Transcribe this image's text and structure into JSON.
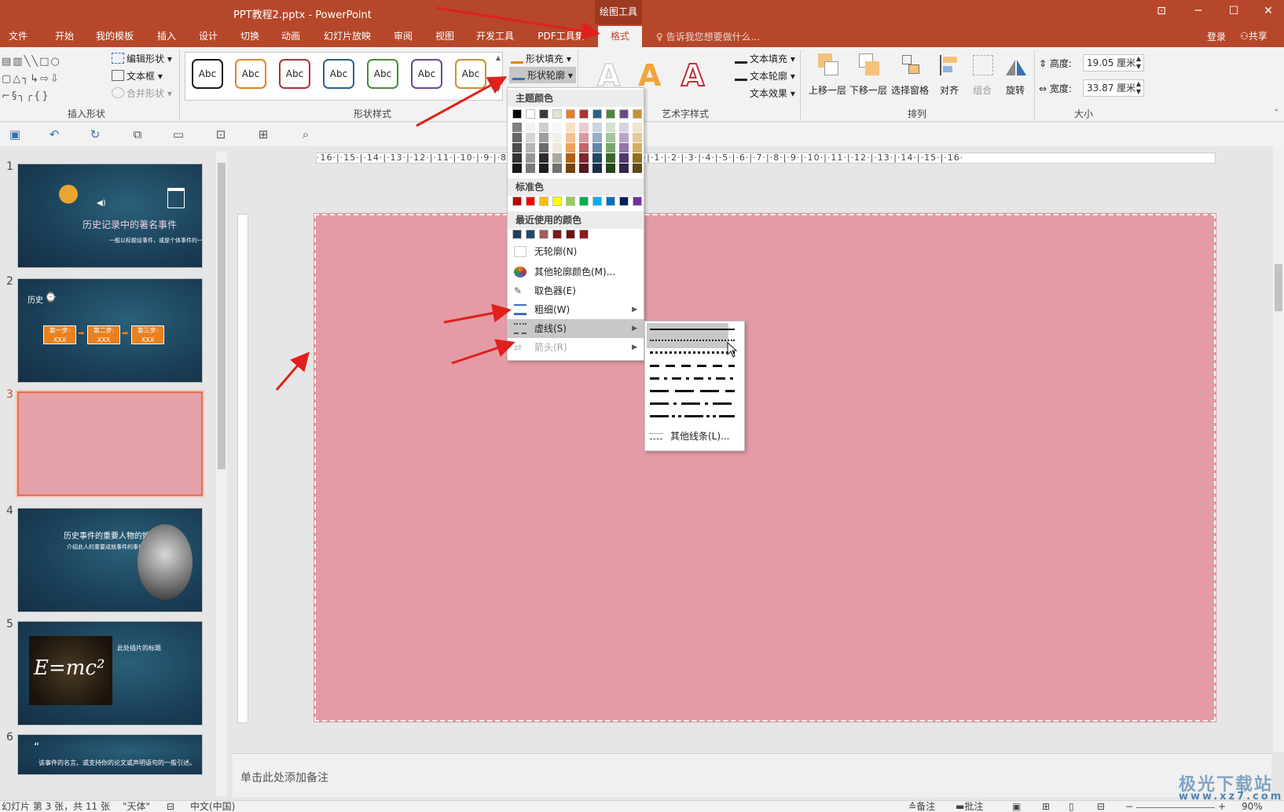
{
  "window": {
    "title": "PPT教程2.pptx - PowerPoint",
    "context_group": "绘图工具",
    "buttons": [
      "⊡",
      "─",
      "☐",
      "✕"
    ]
  },
  "tabs": [
    "文件",
    "开始",
    "我的模板",
    "插入",
    "设计",
    "切换",
    "动画",
    "幻灯片放映",
    "审阅",
    "视图",
    "开发工具",
    "PDF工具集",
    "格式"
  ],
  "active_tab": "格式",
  "tell_me": "告诉我您想要做什么...",
  "account": {
    "login": "登录",
    "share": "共享"
  },
  "ribbon": {
    "insert_shapes": {
      "label": "插入形状",
      "edit_shape": "编辑形状",
      "text_box": "文本框",
      "merge_shapes": "合并形状"
    },
    "shape_styles": {
      "label": "形状样式",
      "sample_text": "Abc",
      "sample_colors": [
        "#1a1a1a",
        "#e8811e",
        "#a9343a",
        "#2e5f8a",
        "#4a8a3c",
        "#6b4a8a",
        "#c4942c"
      ],
      "fill": "形状填充",
      "outline": "形状轮廓"
    },
    "wordart": {
      "label": "艺术字样式",
      "text_fill": "文本填充",
      "text_outline": "文本轮廓",
      "text_effect": "文本效果",
      "glyph": "A"
    },
    "arrange": {
      "label": "排列",
      "bring_forward": "上移一层",
      "send_backward": "下移一层",
      "selection_pane": "选择窗格",
      "align": "对齐",
      "group": "组合",
      "rotate": "旋转"
    },
    "size": {
      "label": "大小",
      "height_label": "高度:",
      "height_value": "19.05 厘米",
      "width_label": "宽度:",
      "width_value": "33.87 厘米"
    }
  },
  "outline_menu": {
    "theme_colors_header": "主题颜色",
    "theme_colors": [
      "#000000",
      "#ffffff",
      "#3a3a3a",
      "#e7e0d6",
      "#e8811e",
      "#a9343a",
      "#2e5f8a",
      "#4a8a3c",
      "#6b4a8a",
      "#c4942c"
    ],
    "standard_header": "标准色",
    "standard_colors": [
      "#c00000",
      "#ff0000",
      "#ffc000",
      "#ffff00",
      "#92d050",
      "#00b050",
      "#00b0f0",
      "#0070c0",
      "#002060",
      "#7030a0"
    ],
    "recent_header": "最近使用的颜色",
    "recent_colors": [
      "#1f3f5a",
      "#1f4a6e",
      "#a45a5a",
      "#7a1a14",
      "#6a1610",
      "#8a1a1a"
    ],
    "no_outline": "无轮廓(N)",
    "more_colors": "其他轮廓颜色(M)...",
    "eyedropper": "取色器(E)",
    "weight": "粗细(W)",
    "dashes": "虚线(S)",
    "arrows": "箭头(R)"
  },
  "dash_menu": {
    "more_lines": "其他线条(L)..."
  },
  "slides": [
    {
      "num": "1",
      "title": "历史记录中的著名事件",
      "subtitle": "一般以标题设事件，或是个体事件的一般记录。"
    },
    {
      "num": "2",
      "title": "历史",
      "steps": [
        "第一步:",
        "第二步:",
        "第三步:"
      ],
      "step_sub": "XXX"
    },
    {
      "num": "3"
    },
    {
      "num": "4",
      "title": "历史事件的重要人物的姓名",
      "subtitle": "介绍此人的重要成就事件的事件。"
    },
    {
      "num": "5",
      "title": "此处插片的标题",
      "formula": "E=mc²"
    },
    {
      "num": "6",
      "quote": "该事件的名言、或支持你的论文或声明语句的一般引述。"
    }
  ],
  "ruler_h": "·16·|·15·|·14·|·13·|·12·|·11·|·10·|·9·|·8·|·7·|·6·|·5·|·4·|·3·|·2·|·1·|·0·|·1·|·2·|·3·|·4·|·5·|·6·|·7·|·8·|·9·|·10·|·11·|·12·|·13·|·14·|·15·|·16·",
  "notes_placeholder": "单击此处添加备注",
  "status": {
    "slide_info": "幻灯片 第 3 张，共 11 张",
    "font": "\"天体\"",
    "language": "中文(中国)",
    "notes": "备注",
    "comments": "批注",
    "zoom": "90%"
  },
  "watermark": {
    "title": "极光下载站",
    "url": "www.xz7.com"
  }
}
